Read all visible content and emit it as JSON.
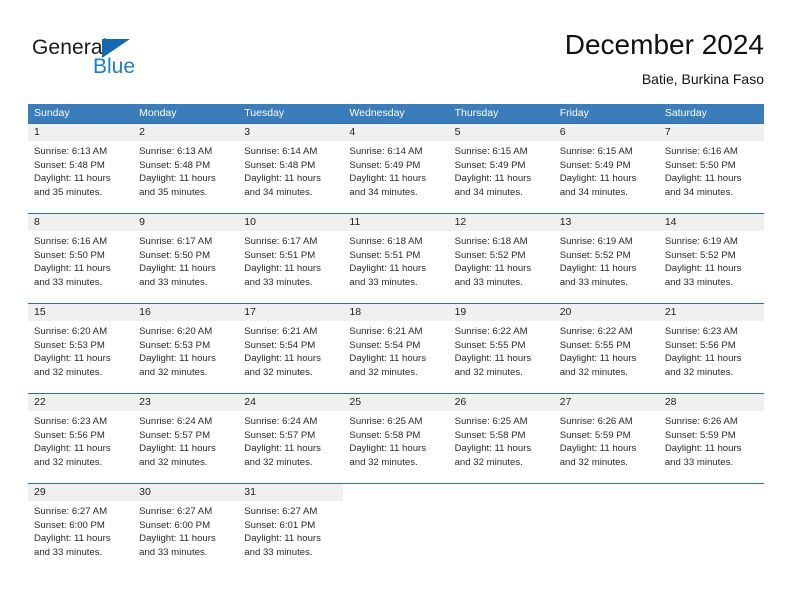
{
  "brand": {
    "name_top": "General",
    "name_bottom": "Blue",
    "triangle_color": "#1269b0",
    "blue_color": "#1d7fc4"
  },
  "header": {
    "title": "December 2024",
    "subtitle": "Batie, Burkina Faso"
  },
  "theme": {
    "header_bg": "#3b7cba",
    "row_rule": "#2f6fae",
    "daynum_band": "#f0f0f0"
  },
  "weekday_headers": [
    "Sunday",
    "Monday",
    "Tuesday",
    "Wednesday",
    "Thursday",
    "Friday",
    "Saturday"
  ],
  "weeks": [
    [
      {
        "day": "1",
        "sunrise": "Sunrise: 6:13 AM",
        "sunset": "Sunset: 5:48 PM",
        "daylight1": "Daylight: 11 hours",
        "daylight2": "and 35 minutes."
      },
      {
        "day": "2",
        "sunrise": "Sunrise: 6:13 AM",
        "sunset": "Sunset: 5:48 PM",
        "daylight1": "Daylight: 11 hours",
        "daylight2": "and 35 minutes."
      },
      {
        "day": "3",
        "sunrise": "Sunrise: 6:14 AM",
        "sunset": "Sunset: 5:48 PM",
        "daylight1": "Daylight: 11 hours",
        "daylight2": "and 34 minutes."
      },
      {
        "day": "4",
        "sunrise": "Sunrise: 6:14 AM",
        "sunset": "Sunset: 5:49 PM",
        "daylight1": "Daylight: 11 hours",
        "daylight2": "and 34 minutes."
      },
      {
        "day": "5",
        "sunrise": "Sunrise: 6:15 AM",
        "sunset": "Sunset: 5:49 PM",
        "daylight1": "Daylight: 11 hours",
        "daylight2": "and 34 minutes."
      },
      {
        "day": "6",
        "sunrise": "Sunrise: 6:15 AM",
        "sunset": "Sunset: 5:49 PM",
        "daylight1": "Daylight: 11 hours",
        "daylight2": "and 34 minutes."
      },
      {
        "day": "7",
        "sunrise": "Sunrise: 6:16 AM",
        "sunset": "Sunset: 5:50 PM",
        "daylight1": "Daylight: 11 hours",
        "daylight2": "and 34 minutes."
      }
    ],
    [
      {
        "day": "8",
        "sunrise": "Sunrise: 6:16 AM",
        "sunset": "Sunset: 5:50 PM",
        "daylight1": "Daylight: 11 hours",
        "daylight2": "and 33 minutes."
      },
      {
        "day": "9",
        "sunrise": "Sunrise: 6:17 AM",
        "sunset": "Sunset: 5:50 PM",
        "daylight1": "Daylight: 11 hours",
        "daylight2": "and 33 minutes."
      },
      {
        "day": "10",
        "sunrise": "Sunrise: 6:17 AM",
        "sunset": "Sunset: 5:51 PM",
        "daylight1": "Daylight: 11 hours",
        "daylight2": "and 33 minutes."
      },
      {
        "day": "11",
        "sunrise": "Sunrise: 6:18 AM",
        "sunset": "Sunset: 5:51 PM",
        "daylight1": "Daylight: 11 hours",
        "daylight2": "and 33 minutes."
      },
      {
        "day": "12",
        "sunrise": "Sunrise: 6:18 AM",
        "sunset": "Sunset: 5:52 PM",
        "daylight1": "Daylight: 11 hours",
        "daylight2": "and 33 minutes."
      },
      {
        "day": "13",
        "sunrise": "Sunrise: 6:19 AM",
        "sunset": "Sunset: 5:52 PM",
        "daylight1": "Daylight: 11 hours",
        "daylight2": "and 33 minutes."
      },
      {
        "day": "14",
        "sunrise": "Sunrise: 6:19 AM",
        "sunset": "Sunset: 5:52 PM",
        "daylight1": "Daylight: 11 hours",
        "daylight2": "and 33 minutes."
      }
    ],
    [
      {
        "day": "15",
        "sunrise": "Sunrise: 6:20 AM",
        "sunset": "Sunset: 5:53 PM",
        "daylight1": "Daylight: 11 hours",
        "daylight2": "and 32 minutes."
      },
      {
        "day": "16",
        "sunrise": "Sunrise: 6:20 AM",
        "sunset": "Sunset: 5:53 PM",
        "daylight1": "Daylight: 11 hours",
        "daylight2": "and 32 minutes."
      },
      {
        "day": "17",
        "sunrise": "Sunrise: 6:21 AM",
        "sunset": "Sunset: 5:54 PM",
        "daylight1": "Daylight: 11 hours",
        "daylight2": "and 32 minutes."
      },
      {
        "day": "18",
        "sunrise": "Sunrise: 6:21 AM",
        "sunset": "Sunset: 5:54 PM",
        "daylight1": "Daylight: 11 hours",
        "daylight2": "and 32 minutes."
      },
      {
        "day": "19",
        "sunrise": "Sunrise: 6:22 AM",
        "sunset": "Sunset: 5:55 PM",
        "daylight1": "Daylight: 11 hours",
        "daylight2": "and 32 minutes."
      },
      {
        "day": "20",
        "sunrise": "Sunrise: 6:22 AM",
        "sunset": "Sunset: 5:55 PM",
        "daylight1": "Daylight: 11 hours",
        "daylight2": "and 32 minutes."
      },
      {
        "day": "21",
        "sunrise": "Sunrise: 6:23 AM",
        "sunset": "Sunset: 5:56 PM",
        "daylight1": "Daylight: 11 hours",
        "daylight2": "and 32 minutes."
      }
    ],
    [
      {
        "day": "22",
        "sunrise": "Sunrise: 6:23 AM",
        "sunset": "Sunset: 5:56 PM",
        "daylight1": "Daylight: 11 hours",
        "daylight2": "and 32 minutes."
      },
      {
        "day": "23",
        "sunrise": "Sunrise: 6:24 AM",
        "sunset": "Sunset: 5:57 PM",
        "daylight1": "Daylight: 11 hours",
        "daylight2": "and 32 minutes."
      },
      {
        "day": "24",
        "sunrise": "Sunrise: 6:24 AM",
        "sunset": "Sunset: 5:57 PM",
        "daylight1": "Daylight: 11 hours",
        "daylight2": "and 32 minutes."
      },
      {
        "day": "25",
        "sunrise": "Sunrise: 6:25 AM",
        "sunset": "Sunset: 5:58 PM",
        "daylight1": "Daylight: 11 hours",
        "daylight2": "and 32 minutes."
      },
      {
        "day": "26",
        "sunrise": "Sunrise: 6:25 AM",
        "sunset": "Sunset: 5:58 PM",
        "daylight1": "Daylight: 11 hours",
        "daylight2": "and 32 minutes."
      },
      {
        "day": "27",
        "sunrise": "Sunrise: 6:26 AM",
        "sunset": "Sunset: 5:59 PM",
        "daylight1": "Daylight: 11 hours",
        "daylight2": "and 32 minutes."
      },
      {
        "day": "28",
        "sunrise": "Sunrise: 6:26 AM",
        "sunset": "Sunset: 5:59 PM",
        "daylight1": "Daylight: 11 hours",
        "daylight2": "and 33 minutes."
      }
    ],
    [
      {
        "day": "29",
        "sunrise": "Sunrise: 6:27 AM",
        "sunset": "Sunset: 6:00 PM",
        "daylight1": "Daylight: 11 hours",
        "daylight2": "and 33 minutes."
      },
      {
        "day": "30",
        "sunrise": "Sunrise: 6:27 AM",
        "sunset": "Sunset: 6:00 PM",
        "daylight1": "Daylight: 11 hours",
        "daylight2": "and 33 minutes."
      },
      {
        "day": "31",
        "sunrise": "Sunrise: 6:27 AM",
        "sunset": "Sunset: 6:01 PM",
        "daylight1": "Daylight: 11 hours",
        "daylight2": "and 33 minutes."
      },
      {
        "day": "",
        "sunrise": "",
        "sunset": "",
        "daylight1": "",
        "daylight2": ""
      },
      {
        "day": "",
        "sunrise": "",
        "sunset": "",
        "daylight1": "",
        "daylight2": ""
      },
      {
        "day": "",
        "sunrise": "",
        "sunset": "",
        "daylight1": "",
        "daylight2": ""
      },
      {
        "day": "",
        "sunrise": "",
        "sunset": "",
        "daylight1": "",
        "daylight2": ""
      }
    ]
  ]
}
